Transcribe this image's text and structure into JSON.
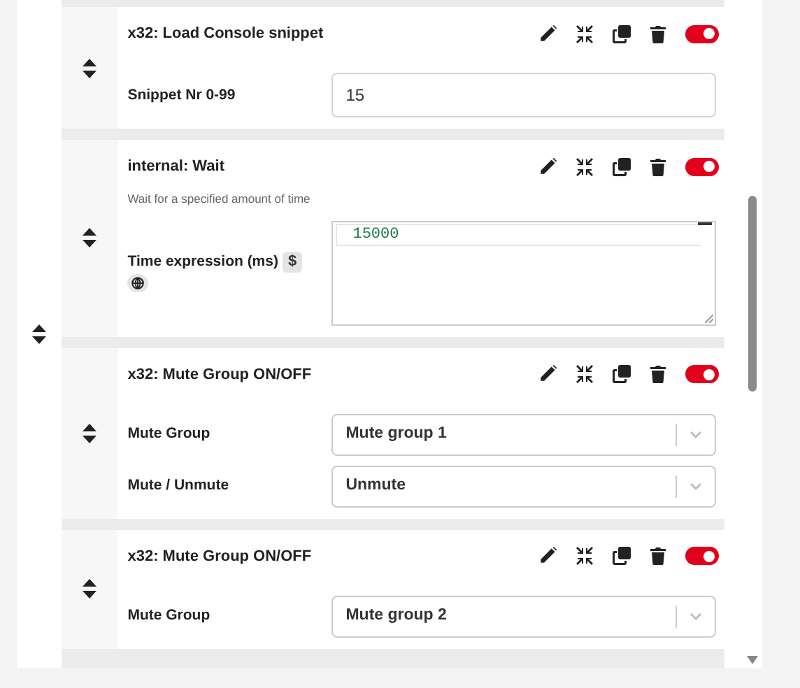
{
  "actions": [
    {
      "title": "x32: Load Console snippet",
      "enabled": true,
      "fields": [
        {
          "kind": "text",
          "label": "Snippet Nr 0-99",
          "value": "15"
        }
      ]
    },
    {
      "title": "internal: Wait",
      "enabled": true,
      "description": "Wait for a specified amount of time",
      "fields": [
        {
          "kind": "expression",
          "label": "Time expression (ms)",
          "badge": "$",
          "value": "15000"
        }
      ]
    },
    {
      "title": "x32: Mute Group ON/OFF",
      "enabled": true,
      "fields": [
        {
          "kind": "select",
          "label": "Mute Group",
          "value": "Mute group 1"
        },
        {
          "kind": "select",
          "label": "Mute / Unmute",
          "value": "Unmute"
        }
      ]
    },
    {
      "title": "x32: Mute Group ON/OFF",
      "enabled": true,
      "fields": [
        {
          "kind": "select",
          "label": "Mute Group",
          "value": "Mute group 2"
        }
      ]
    }
  ]
}
